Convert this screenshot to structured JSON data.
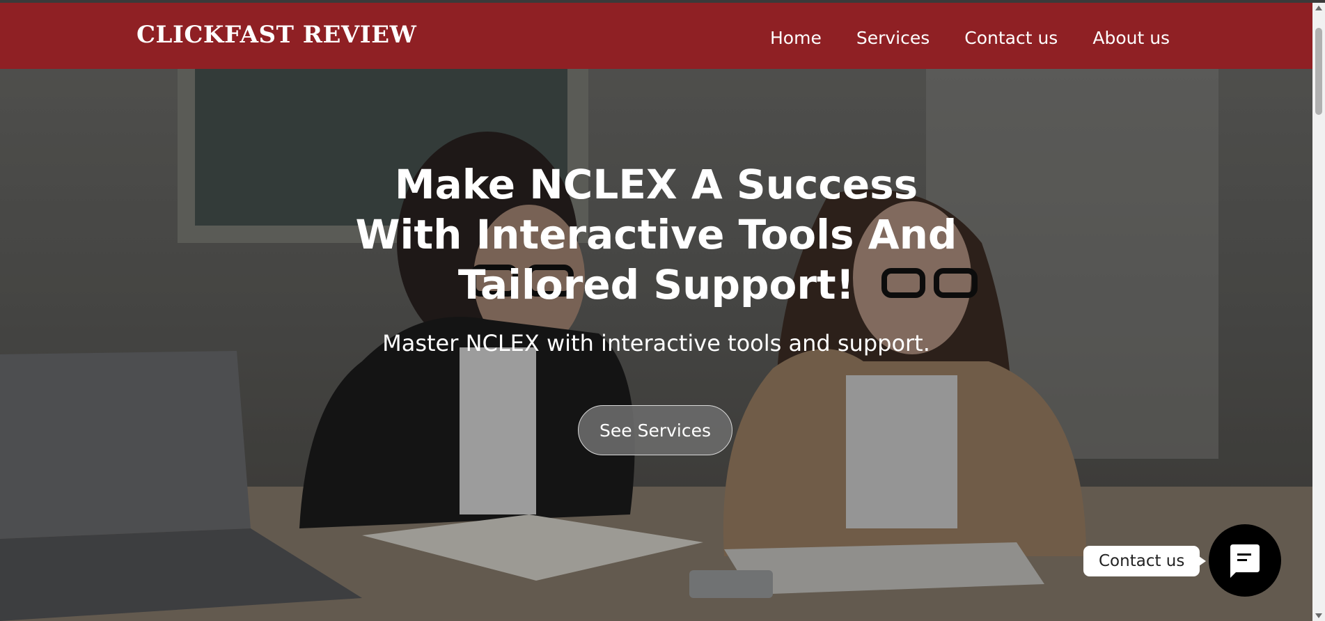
{
  "nav": {
    "logo": "CLICKFAST REVIEW",
    "links": [
      {
        "label": "Home"
      },
      {
        "label": "Services"
      },
      {
        "label": "Contact us"
      },
      {
        "label": "About us"
      }
    ]
  },
  "hero": {
    "title": "Make NCLEX A Success With Interactive Tools And Tailored Support!",
    "subtitle": "Master NCLEX with interactive tools and support.",
    "cta_label": "See Services",
    "background_image": "photo of two women studying at a desk with books and a laptop"
  },
  "chat_widget": {
    "label": "Contact us",
    "icon": "chat-bubble-icon"
  },
  "colors": {
    "nav_background": "#8f2024",
    "cta_background": "#6a6a6a",
    "chat_button_background": "#000000"
  }
}
